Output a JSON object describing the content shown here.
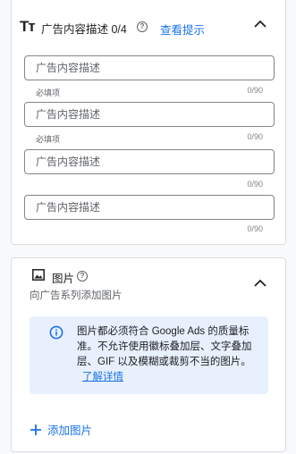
{
  "desc_section": {
    "title": "广告内容描述 0/4",
    "hint_link": "查看提示",
    "fields": [
      {
        "placeholder": "广告内容描述",
        "required": "必填项",
        "count": "0/90"
      },
      {
        "placeholder": "广告内容描述",
        "required": "必填项",
        "count": "0/90"
      },
      {
        "placeholder": "广告内容描述",
        "required": "",
        "count": "0/90"
      },
      {
        "placeholder": "广告内容描述",
        "required": "",
        "count": "0/90"
      }
    ]
  },
  "image_section": {
    "title": "图片",
    "subtitle": "向广告系列添加图片",
    "info_text": "图片都必须符合 Google Ads 的质量标准。不允许使用徽标叠加层、文字叠加层、GIF 以及模糊或裁剪不当的图片。",
    "learn_more": "了解详情",
    "add_label": "添加图片"
  },
  "colors": {
    "link": "#1a73e8",
    "info_bg": "#e8f0fe",
    "border": "#dadce0"
  }
}
